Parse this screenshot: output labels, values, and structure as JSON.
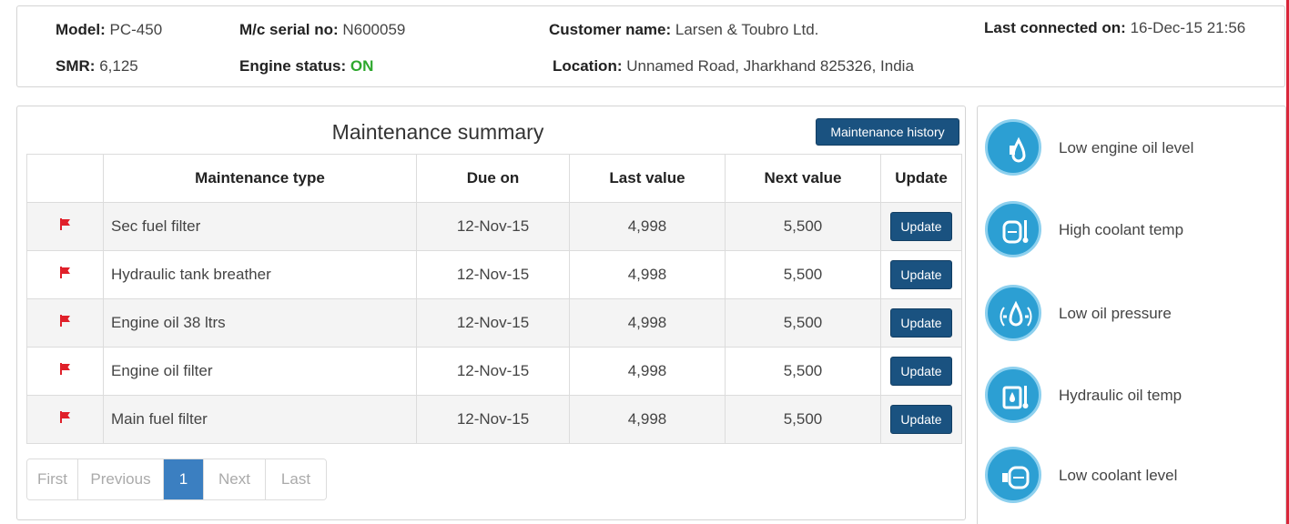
{
  "header": {
    "model_label": "Model:",
    "model_value": "PC-450",
    "smr_label": "SMR:",
    "smr_value": "6,125",
    "serial_label": "M/c serial no:",
    "serial_value": "N600059",
    "engine_label": "Engine status:",
    "engine_value": "ON",
    "customer_label": "Customer name:",
    "customer_value": "Larsen & Toubro Ltd.",
    "location_label": "Location:",
    "location_value": "Unnamed Road, Jharkhand 825326, India",
    "last_connected_label": "Last connected on:",
    "last_connected_value": "16-Dec-15 21:56"
  },
  "maintenance": {
    "title": "Maintenance summary",
    "history_button": "Maintenance history",
    "columns": [
      "",
      "Maintenance type",
      "Due on",
      "Last value",
      "Next value",
      "Update"
    ],
    "rows": [
      {
        "type": "Sec fuel filter",
        "due": "12-Nov-15",
        "last": "4,998",
        "next": "5,500",
        "button": "Update"
      },
      {
        "type": "Hydraulic tank breather",
        "due": "12-Nov-15",
        "last": "4,998",
        "next": "5,500",
        "button": "Update"
      },
      {
        "type": "Engine oil 38 ltrs",
        "due": "12-Nov-15",
        "last": "4,998",
        "next": "5,500",
        "button": "Update"
      },
      {
        "type": "Engine oil filter",
        "due": "12-Nov-15",
        "last": "4,998",
        "next": "5,500",
        "button": "Update"
      },
      {
        "type": "Main fuel filter",
        "due": "12-Nov-15",
        "last": "4,998",
        "next": "5,500",
        "button": "Update"
      }
    ],
    "flag_color": "#e0202a"
  },
  "pagination": {
    "first": "First",
    "previous": "Previous",
    "current": "1",
    "next": "Next",
    "last": "Last"
  },
  "alerts": [
    {
      "label": "Low engine oil level",
      "icon": "engine-oil-level-icon"
    },
    {
      "label": "High coolant temp",
      "icon": "coolant-temp-icon"
    },
    {
      "label": "Low oil pressure",
      "icon": "oil-pressure-icon"
    },
    {
      "label": "Hydraulic oil temp",
      "icon": "hydraulic-oil-temp-icon"
    },
    {
      "label": "Low coolant level",
      "icon": "coolant-level-icon"
    }
  ],
  "colors": {
    "brand_button": "#1a5280",
    "engine_on": "#2ea82e",
    "pager_active": "#3b7fc1",
    "alert_icon": "#2c9fd3"
  }
}
